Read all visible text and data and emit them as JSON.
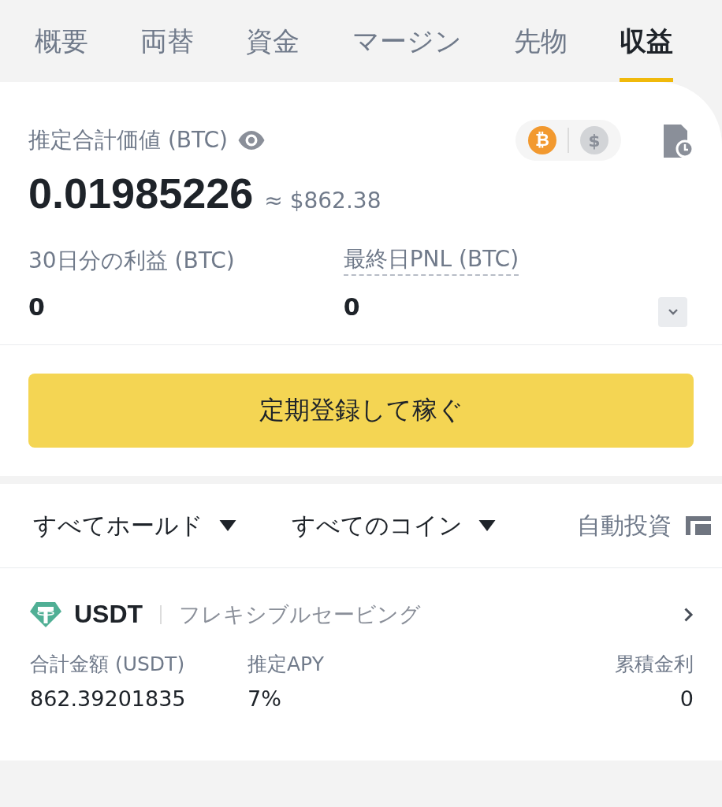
{
  "tabs": [
    {
      "label": "概要",
      "selected": false
    },
    {
      "label": "両替",
      "selected": false
    },
    {
      "label": "資金",
      "selected": false
    },
    {
      "label": "マージン",
      "selected": false
    },
    {
      "label": "先物",
      "selected": false
    },
    {
      "label": "収益",
      "selected": true
    }
  ],
  "summary": {
    "label": "推定合計価値 (BTC)",
    "currencies": [
      {
        "symbol": "₿",
        "selected": true
      },
      {
        "symbol": "$",
        "selected": false
      }
    ],
    "total": "0.01985226",
    "approx": "≈ $862.38",
    "stats": [
      {
        "label": "30日分の利益 (BTC)",
        "value": "0",
        "underlined": false
      },
      {
        "label": "最終日PNL (BTC)",
        "value": "0",
        "underlined": true
      }
    ]
  },
  "cta": "定期登録して稼ぐ",
  "filters": [
    {
      "label": "すべてホールド",
      "kind": "dropdown"
    },
    {
      "label": "すべてのコイン",
      "kind": "dropdown"
    },
    {
      "label": "自動投資",
      "kind": "toggle"
    }
  ],
  "assets": [
    {
      "coin": "USDT",
      "product": "フレキシブルセービング",
      "fields": [
        {
          "label": "合計金額 (USDT)",
          "value": "862.39201835"
        },
        {
          "label": "推定APY",
          "value": "7%"
        },
        {
          "label": "累積金利",
          "value": "0"
        }
      ]
    }
  ]
}
